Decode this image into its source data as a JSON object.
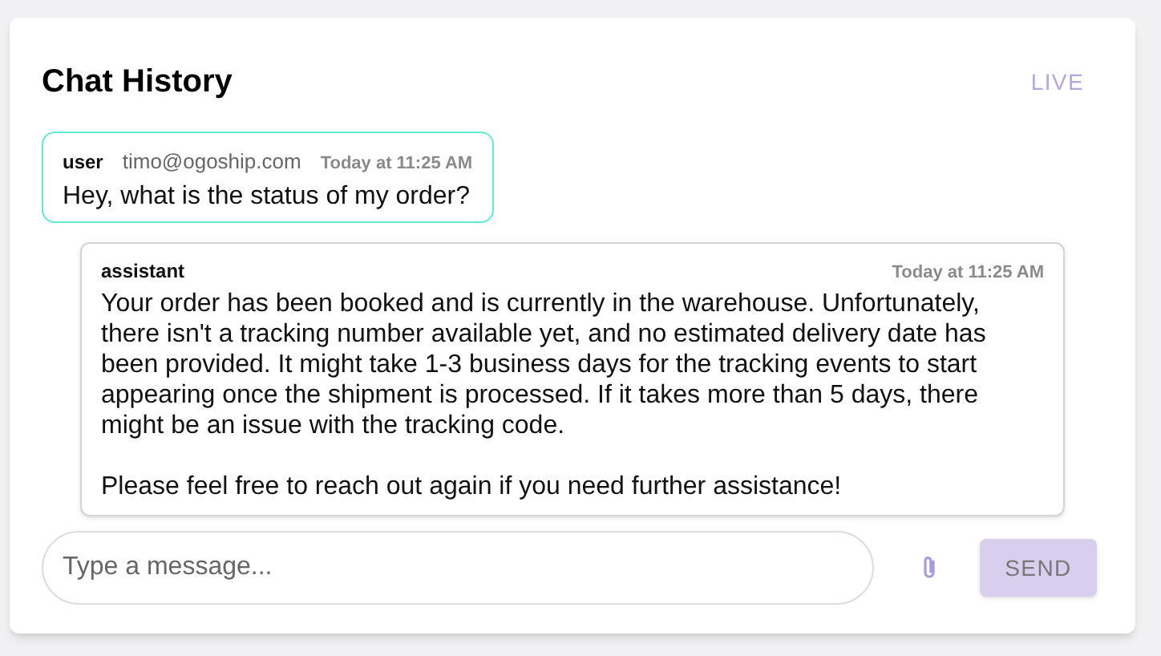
{
  "header": {
    "title": "Chat History",
    "status": "LIVE"
  },
  "messages": [
    {
      "kind": "user",
      "role": "user",
      "sender": "timo@ogoship.com",
      "time": "Today at 11:25 AM",
      "paragraphs": [
        "Hey, what is the status of my order?"
      ]
    },
    {
      "kind": "assistant",
      "role": "assistant",
      "time": "Today at 11:25 AM",
      "paragraphs": [
        "Your order has been booked and is currently in the warehouse. Unfortunately, there isn't a tracking number available yet, and no estimated delivery date has been provided. It might take 1-3 business days for the tracking events to start appearing once the shipment is processed. If it takes more than 5 days, there might be an issue with the tracking code.",
        "Please feel free to reach out again if you need further assistance!"
      ]
    }
  ],
  "composer": {
    "placeholder": "Type a message...",
    "send": {
      "label": "SEND",
      "disabled": true
    }
  }
}
